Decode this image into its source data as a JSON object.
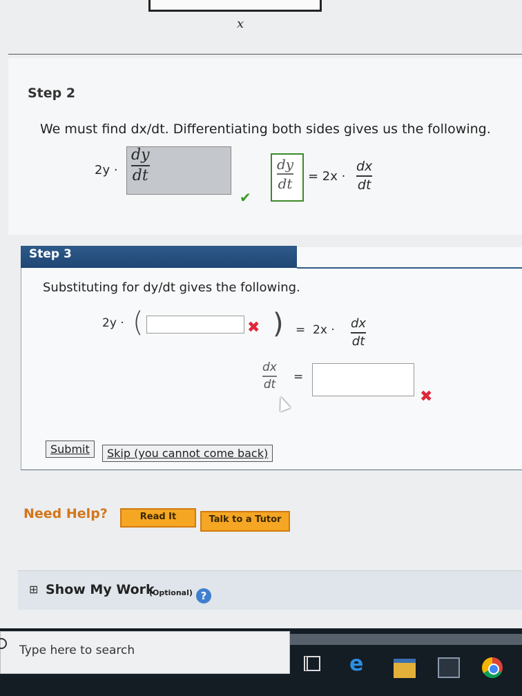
{
  "figure": {
    "axis_label": "x"
  },
  "step2": {
    "title": "Step 2",
    "text": "We must find dx/dt. Differentiating both sides gives us the following.",
    "lhs_coef": "2y ·",
    "answer_num": "dy",
    "answer_den": "dt",
    "rhs_num": "dy",
    "rhs_den": "dt",
    "rhs_eq": "= 2x ·",
    "rhs_frac_num": "dx",
    "rhs_frac_den": "dt",
    "check": "✔"
  },
  "step3": {
    "title": "Step 3",
    "text": "Substituting for dy/dt gives the following.",
    "lhs_coef": "2y ·",
    "paren_open": "(",
    "paren_close": ")",
    "eq_rhs": "=  2x ·",
    "frac_num": "dx",
    "frac_den": "dt",
    "result_num": "dx",
    "result_den": "dt",
    "result_eq": "=",
    "input1_value": "",
    "input2_value": "",
    "wrong_mark": "✖",
    "submit_label": "Submit",
    "skip_label": "Skip (you cannot come back)"
  },
  "help": {
    "label": "Need Help?",
    "read_label": "Read It",
    "tutor_label": "Talk to a Tutor"
  },
  "show_work": {
    "expander": "⊞",
    "label": "Show My Work",
    "optional": "(Optional)",
    "help_icon": "?"
  },
  "taskbar": {
    "search_placeholder": "Type here to search",
    "accent": "#1e2b3a"
  }
}
